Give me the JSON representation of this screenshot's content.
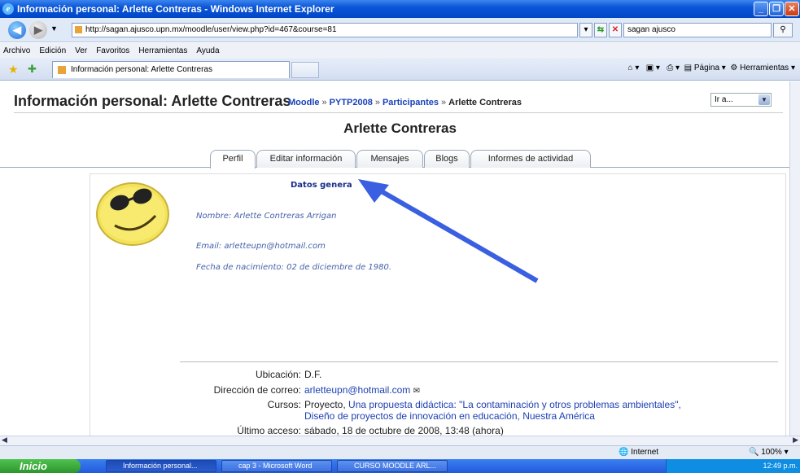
{
  "window": {
    "title": "Información personal: Arlette Contreras - Windows Internet Explorer",
    "url": "http://sagan.ajusco.upn.mx/moodle/user/view.php?id=467&course=81",
    "search_value": "sagan ajusco",
    "menu": [
      "Archivo",
      "Edición",
      "Ver",
      "Favoritos",
      "Herramientas",
      "Ayuda"
    ],
    "tab_title": "Información personal: Arlette Contreras",
    "cmd_page": "Página",
    "cmd_tools": "Herramientas"
  },
  "page": {
    "heading": "Información personal: Arlette Contreras",
    "breadcrumb": [
      {
        "label": "Moodle"
      },
      {
        "label": "PYTP2008"
      },
      {
        "label": "Participantes"
      },
      {
        "label": "Arlette Contreras"
      }
    ],
    "breadcrumb_sep": "»",
    "jump_label": "Ir a...",
    "user_name": "Arlette Contreras",
    "tabs": [
      "Perfil",
      "Editar información",
      "Mensajes",
      "Blogs",
      "Informes de actividad"
    ],
    "selected_tab": "Perfil",
    "section_title": "Datos genera",
    "nombre_label": "Nombre:",
    "nombre_value": "Arlette Contreras Arrigan",
    "email_label": "Email:",
    "email_value": "arletteupn@hotmail.com",
    "fecha_label": "Fecha de nacimiento:",
    "fecha_value": "02 de diciembre de 1980.",
    "ubicacion_label": "Ubicación:",
    "ubicacion_value": "D.F.",
    "correo_label": "Dirección de correo:",
    "correo_value": "arletteupn@hotmail.com",
    "cursos_label": "Cursos:",
    "cursos_plain": "Proyecto,",
    "cursos_link1": "Una propuesta didáctica: \"La contaminación y otros problemas ambientales\",",
    "cursos_link2": "Diseño de proyectos de innovación en educación",
    "cursos_sep": ",",
    "cursos_link3": "Nuestra América",
    "acceso_label": "Último acceso:",
    "acceso_value": "sábado, 18 de octubre de 2008, 13:48  (ahora)"
  },
  "status": {
    "zone": "Internet",
    "zoom": "100%"
  },
  "taskbar": {
    "start": "Inicio",
    "tasks": [
      "Información personal...",
      "cap 3 - Microsoft Word",
      "CURSO MOODLE ARL..."
    ],
    "clock": "12:49 p.m."
  },
  "colors": {
    "titlebar": "#0a55d8",
    "link": "#1d3fb2",
    "arrow": "#3a5fe0"
  }
}
